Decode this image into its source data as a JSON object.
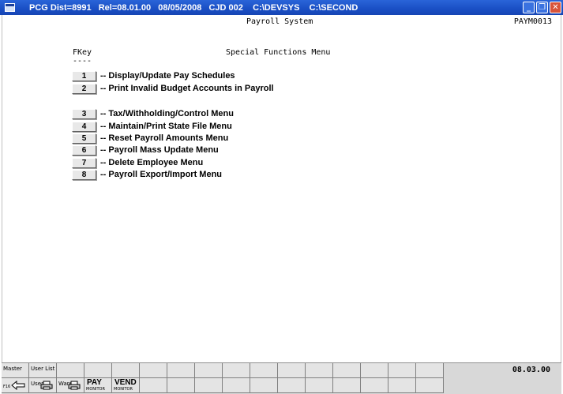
{
  "window": {
    "title": "PCG Dist=8991   Rel=08.01.00   08/05/2008   CJD 002    C:\\DEVSYS    C:\\SECOND",
    "controls": [
      "minimize-icon",
      "maximize-icon",
      "close-icon"
    ]
  },
  "header": {
    "system_title": "Payroll System",
    "screen_id": "PAYM0013",
    "fkey_label": "FKey",
    "fkey_underline": "----",
    "menu_title": "Special Functions Menu"
  },
  "menu": {
    "items": [
      {
        "key": "1",
        "label": "-- Display/Update Pay Schedules"
      },
      {
        "key": "2",
        "label": "-- Print Invalid Budget Accounts in Payroll"
      },
      {
        "key": "3",
        "label": "-- Tax/Withholding/Control Menu"
      },
      {
        "key": "4",
        "label": "-- Maintain/Print State File Menu"
      },
      {
        "key": "5",
        "label": "-- Reset Payroll Amounts Menu"
      },
      {
        "key": "6",
        "label": "-- Payroll Mass Update Menu"
      },
      {
        "key": "7",
        "label": "-- Delete Employee Menu"
      },
      {
        "key": "8",
        "label": "-- Payroll Export/Import Menu"
      }
    ]
  },
  "function_bar": {
    "master": "Master",
    "user_list": "User List",
    "f16": "F16",
    "user_prefix": "User",
    "ware_prefix": "Ware",
    "pay_label": "PAY",
    "pay_sub": "MONITOR",
    "vend_label": "VEND",
    "vend_sub": "MONITOR",
    "version": "08.03.00"
  }
}
